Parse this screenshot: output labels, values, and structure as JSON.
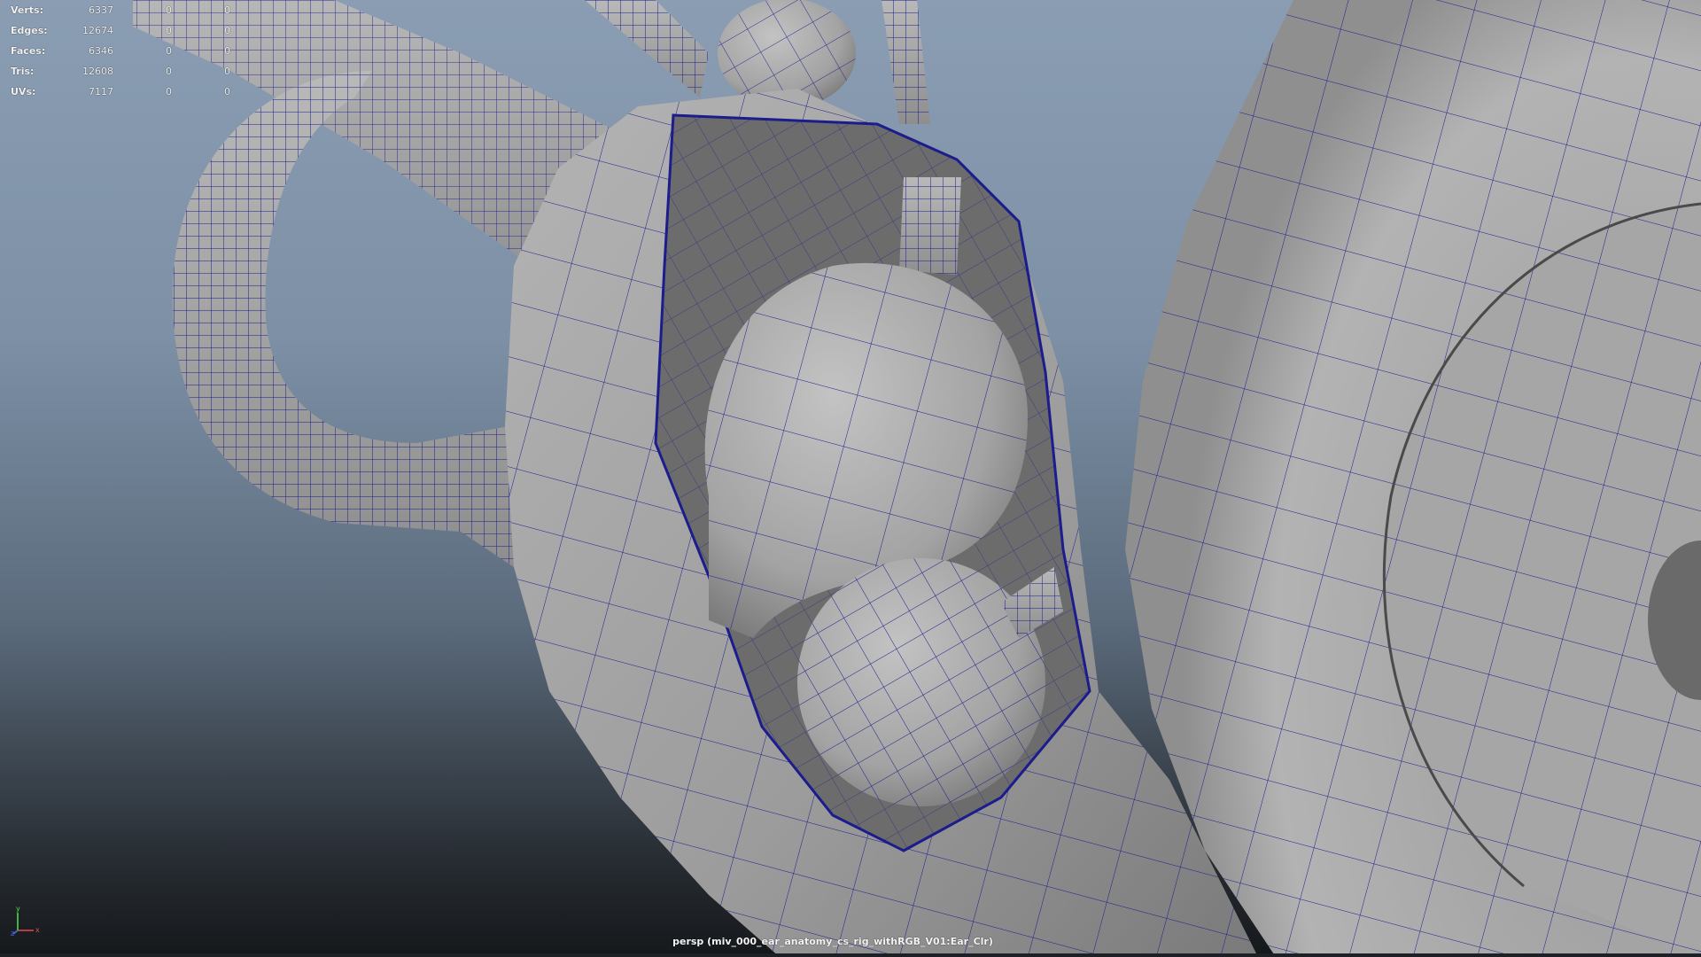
{
  "hud": {
    "rows": [
      {
        "label": "Verts:",
        "total": "6337",
        "selected": "0",
        "component": "0"
      },
      {
        "label": "Edges:",
        "total": "12674",
        "selected": "0",
        "component": "0"
      },
      {
        "label": "Faces:",
        "total": "6346",
        "selected": "0",
        "component": "0"
      },
      {
        "label": "Tris:",
        "total": "12608",
        "selected": "0",
        "component": "0"
      },
      {
        "label": "UVs:",
        "total": "7117",
        "selected": "0",
        "component": "0"
      }
    ]
  },
  "camera": {
    "label": "persp (miv_000_ear_anatomy_cs_rig_withRGB_V01:Ear_Clr)"
  },
  "axis": {
    "y": "y",
    "x": "x",
    "z": "z"
  },
  "colors": {
    "background_top": "#8a9db3",
    "background_bottom": "#15181b",
    "mesh_surface": "#a9a9a9",
    "wireframe": "#1c1c8c"
  }
}
